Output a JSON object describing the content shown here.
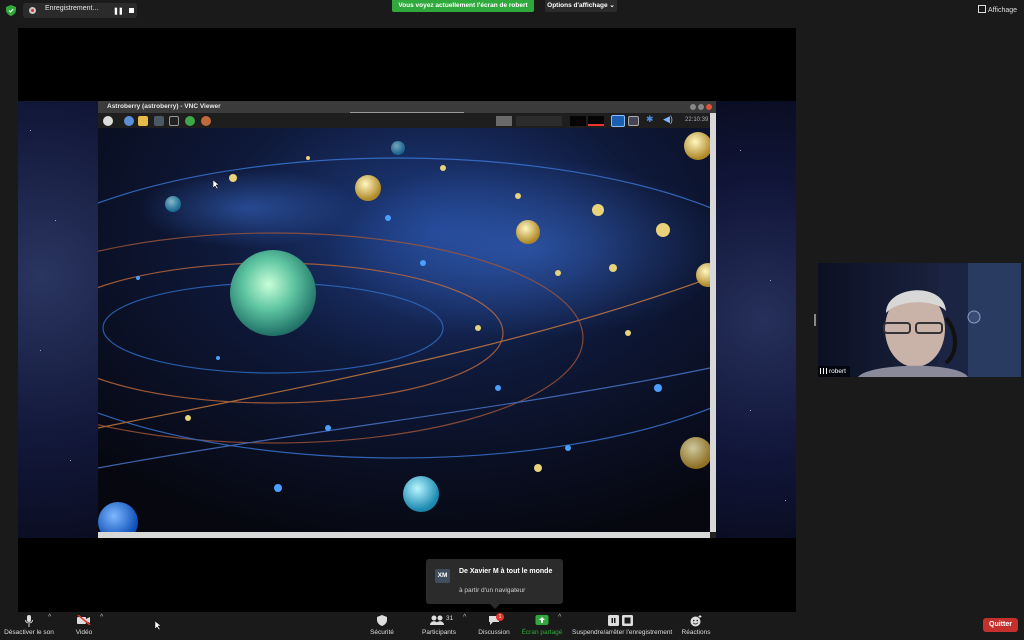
{
  "topbar": {
    "recording_label": "Enregistrement...",
    "share_banner": "Vous voyez actuellement l'écran de robert",
    "view_options": "Options d'affichage",
    "view_button": "Affichage"
  },
  "vnc": {
    "title": "Astroberry (astroberry) - VNC Viewer",
    "clock": "22:10:39"
  },
  "notification": {
    "avatar_initials": "XM",
    "title": "De Xavier M à tout le monde",
    "body": "à partir d'un navigateur"
  },
  "participant": {
    "name": "robert"
  },
  "toolbar": {
    "mute": "Désactiver le son",
    "video": "Vidéo",
    "security": "Sécurité",
    "participants": "Participants",
    "participants_count": "31",
    "chat": "Discussion",
    "chat_badge": "1",
    "share": "Écran partagé",
    "record": "Suspendre/arrêter l'enregistrement",
    "reactions": "Réactions",
    "quit": "Quitter"
  },
  "colors": {
    "share_green": "#2fa93b",
    "quit_red": "#c4312d"
  }
}
